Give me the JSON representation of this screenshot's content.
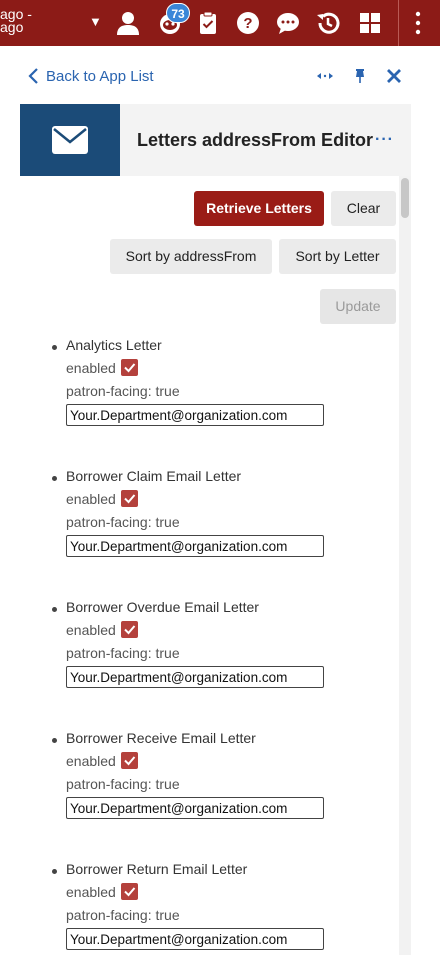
{
  "topbar": {
    "institution_line1": "ago -",
    "institution_line2": "ago",
    "notification_count": "73"
  },
  "nav": {
    "back_label": "Back to App List"
  },
  "app": {
    "title": "Letters addressFrom Editor",
    "menu": "···"
  },
  "buttons": {
    "retrieve": "Retrieve Letters",
    "clear": "Clear",
    "sort_address": "Sort by addressFrom",
    "sort_letter": "Sort by Letter",
    "update": "Update"
  },
  "letters": [
    {
      "name": "Analytics Letter",
      "enabled_label": "enabled",
      "patron_facing": "patron-facing: true",
      "address": "Your.Department@organization.com"
    },
    {
      "name": "Borrower Claim Email Letter",
      "enabled_label": "enabled",
      "patron_facing": "patron-facing: true",
      "address": "Your.Department@organization.com"
    },
    {
      "name": "Borrower Overdue Email Letter",
      "enabled_label": "enabled",
      "patron_facing": "patron-facing: true",
      "address": "Your.Department@organization.com"
    },
    {
      "name": "Borrower Receive Email Letter",
      "enabled_label": "enabled",
      "patron_facing": "patron-facing: true",
      "address": "Your.Department@organization.com"
    },
    {
      "name": "Borrower Return Email Letter",
      "enabled_label": "enabled",
      "patron_facing": "patron-facing: true",
      "address": "Your.Department@organization.com"
    }
  ],
  "colors": {
    "topbar": "#8c1b17",
    "primary_button": "#9a1c16",
    "link": "#2a64b0",
    "app_icon_bg": "#1b4b78",
    "checkbox": "#b4413c"
  }
}
